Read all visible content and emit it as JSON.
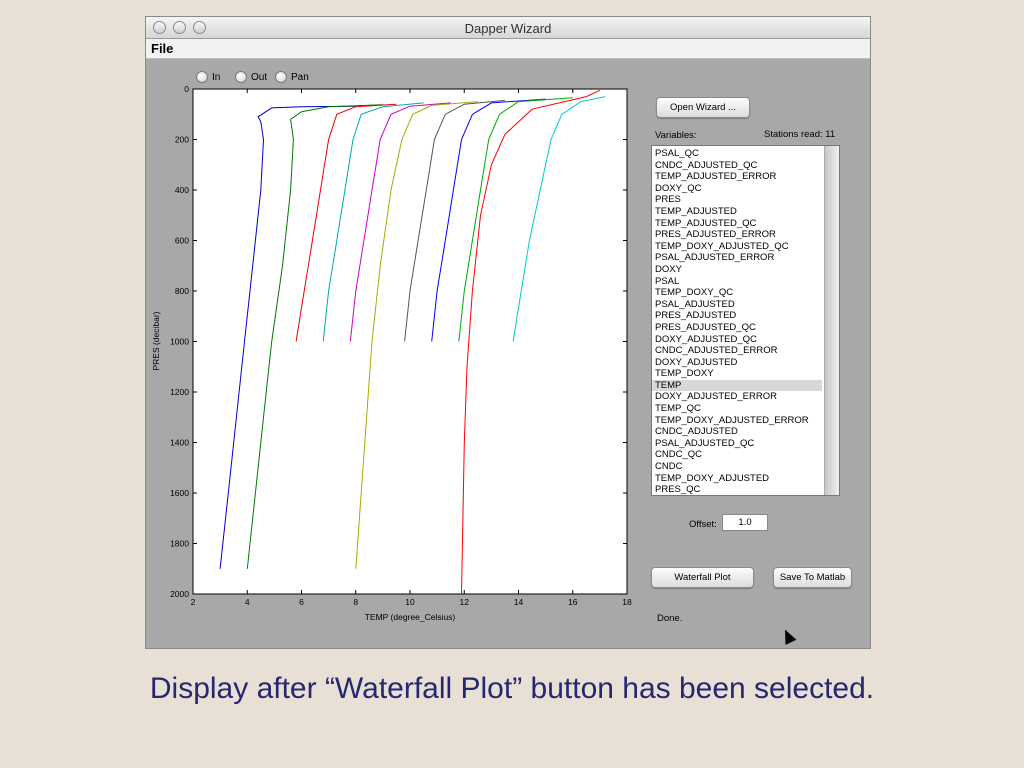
{
  "window": {
    "title": "Dapper Wizard"
  },
  "menu": {
    "file": "File"
  },
  "zoom_controls": {
    "in": "In",
    "out": "Out",
    "pan": "Pan"
  },
  "chart_data": {
    "type": "line",
    "title": "",
    "xlabel": "TEMP (degree_Celsius)",
    "ylabel": "PRES (decibar)",
    "xlim": [
      2,
      18
    ],
    "ylim": [
      0,
      2000
    ],
    "y_inverted": true,
    "xticks": [
      2,
      4,
      6,
      8,
      10,
      12,
      14,
      16,
      18
    ],
    "yticks": [
      0,
      200,
      400,
      600,
      800,
      1000,
      1200,
      1400,
      1600,
      1800,
      2000
    ],
    "grid": false,
    "series": [
      {
        "color": "#0000cc",
        "points": [
          [
            3.0,
            1900
          ],
          [
            3.3,
            1600
          ],
          [
            3.6,
            1300
          ],
          [
            3.9,
            1000
          ],
          [
            4.2,
            700
          ],
          [
            4.5,
            400
          ],
          [
            4.6,
            200
          ],
          [
            4.5,
            130
          ],
          [
            4.4,
            110
          ],
          [
            4.9,
            75
          ],
          [
            6.0,
            70
          ],
          [
            8.0,
            68
          ]
        ]
      },
      {
        "color": "#007700",
        "points": [
          [
            4.0,
            1900
          ],
          [
            4.3,
            1600
          ],
          [
            4.6,
            1300
          ],
          [
            4.9,
            1000
          ],
          [
            5.3,
            700
          ],
          [
            5.6,
            400
          ],
          [
            5.7,
            200
          ],
          [
            5.6,
            120
          ],
          [
            6.0,
            90
          ],
          [
            7.0,
            70
          ],
          [
            9.0,
            62
          ]
        ]
      },
      {
        "color": "#ee0000",
        "points": [
          [
            5.8,
            1000
          ],
          [
            6.1,
            800
          ],
          [
            6.4,
            600
          ],
          [
            6.7,
            400
          ],
          [
            7.0,
            200
          ],
          [
            7.3,
            100
          ],
          [
            8.0,
            70
          ],
          [
            9.5,
            60
          ]
        ]
      },
      {
        "color": "#00aaaa",
        "points": [
          [
            6.8,
            1000
          ],
          [
            7.0,
            800
          ],
          [
            7.3,
            600
          ],
          [
            7.6,
            400
          ],
          [
            7.9,
            200
          ],
          [
            8.2,
            100
          ],
          [
            9.0,
            70
          ],
          [
            10.5,
            55
          ]
        ]
      },
      {
        "color": "#cc00cc",
        "points": [
          [
            7.8,
            1000
          ],
          [
            8.0,
            800
          ],
          [
            8.3,
            600
          ],
          [
            8.6,
            400
          ],
          [
            8.9,
            200
          ],
          [
            9.3,
            100
          ],
          [
            10.0,
            68
          ],
          [
            11.5,
            55
          ]
        ]
      },
      {
        "color": "#aaaa00",
        "points": [
          [
            8.0,
            1900
          ],
          [
            8.2,
            1600
          ],
          [
            8.4,
            1300
          ],
          [
            8.6,
            1000
          ],
          [
            8.9,
            700
          ],
          [
            9.3,
            400
          ],
          [
            9.7,
            200
          ],
          [
            10.1,
            100
          ],
          [
            10.8,
            65
          ],
          [
            12.5,
            50
          ]
        ]
      },
      {
        "color": "#555555",
        "points": [
          [
            9.8,
            1000
          ],
          [
            10.0,
            800
          ],
          [
            10.3,
            600
          ],
          [
            10.6,
            400
          ],
          [
            10.9,
            200
          ],
          [
            11.3,
            100
          ],
          [
            12.0,
            60
          ],
          [
            13.5,
            45
          ]
        ]
      },
      {
        "color": "#0000ff",
        "points": [
          [
            10.8,
            1000
          ],
          [
            11.0,
            800
          ],
          [
            11.3,
            600
          ],
          [
            11.6,
            400
          ],
          [
            11.9,
            200
          ],
          [
            12.3,
            100
          ],
          [
            13.0,
            55
          ],
          [
            15.0,
            40
          ]
        ]
      },
      {
        "color": "#00aa00",
        "points": [
          [
            11.8,
            1000
          ],
          [
            12.0,
            800
          ],
          [
            12.3,
            600
          ],
          [
            12.6,
            400
          ],
          [
            12.9,
            200
          ],
          [
            13.3,
            100
          ],
          [
            14.0,
            50
          ],
          [
            16.0,
            35
          ]
        ]
      },
      {
        "color": "#ff0000",
        "points": [
          [
            11.9,
            2000
          ],
          [
            11.95,
            1700
          ],
          [
            12.0,
            1400
          ],
          [
            12.1,
            1100
          ],
          [
            12.3,
            800
          ],
          [
            12.6,
            500
          ],
          [
            13.0,
            300
          ],
          [
            13.5,
            180
          ],
          [
            14.5,
            80
          ],
          [
            16.5,
            30
          ],
          [
            17.0,
            5
          ]
        ]
      },
      {
        "color": "#00cccc",
        "points": [
          [
            13.8,
            1000
          ],
          [
            14.1,
            800
          ],
          [
            14.4,
            600
          ],
          [
            14.8,
            400
          ],
          [
            15.2,
            200
          ],
          [
            15.6,
            100
          ],
          [
            16.3,
            50
          ],
          [
            17.2,
            30
          ]
        ]
      }
    ]
  },
  "controls": {
    "open_wizard": "Open Wizard ...",
    "variables_label": "Variables:",
    "stations_read": "Stations read: 11",
    "offset_label": "Offset:",
    "offset_value": "1.0",
    "waterfall_plot": "Waterfall Plot",
    "save_to_matlab": "Save To Matlab",
    "status": "Done."
  },
  "variables": {
    "items": [
      "PSAL_QC",
      "CNDC_ADJUSTED_QC",
      "TEMP_ADJUSTED_ERROR",
      "DOXY_QC",
      "PRES",
      "TEMP_ADJUSTED",
      "TEMP_ADJUSTED_QC",
      "PRES_ADJUSTED_ERROR",
      "TEMP_DOXY_ADJUSTED_QC",
      "PSAL_ADJUSTED_ERROR",
      "DOXY",
      "PSAL",
      "TEMP_DOXY_QC",
      "PSAL_ADJUSTED",
      "PRES_ADJUSTED",
      "PRES_ADJUSTED_QC",
      "DOXY_ADJUSTED_QC",
      "CNDC_ADJUSTED_ERROR",
      "DOXY_ADJUSTED",
      "TEMP_DOXY",
      "TEMP",
      "DOXY_ADJUSTED_ERROR",
      "TEMP_QC",
      "TEMP_DOXY_ADJUSTED_ERROR",
      "CNDC_ADJUSTED",
      "PSAL_ADJUSTED_QC",
      "CNDC_QC",
      "CNDC",
      "TEMP_DOXY_ADJUSTED",
      "PRES_QC"
    ],
    "selected": "TEMP"
  },
  "caption": "Display after “Waterfall Plot” button has been selected."
}
